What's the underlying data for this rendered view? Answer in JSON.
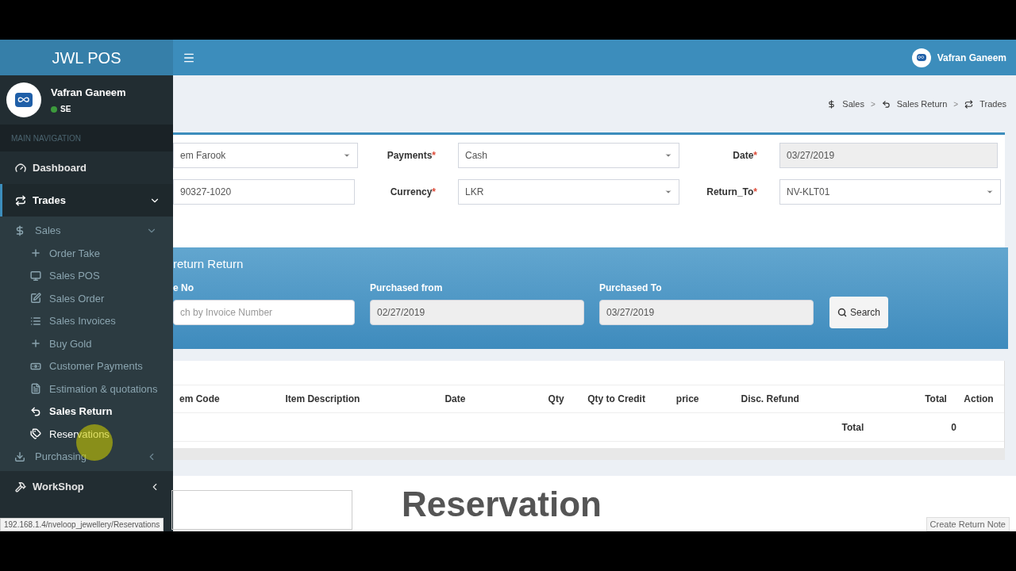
{
  "app_title": "JWL POS",
  "user": {
    "name": "Vafran Ganeem",
    "role": "SE",
    "online": true
  },
  "nav_heading": "MAIN NAVIGATION",
  "nav": [
    {
      "label": "Dashboard",
      "kind": "dashboard",
      "selected": false
    },
    {
      "label": "Trades",
      "kind": "trades",
      "expanded": true,
      "selected": true,
      "children": [
        {
          "label": "Sales",
          "kind": "dollar",
          "expanded": true,
          "children": [
            {
              "label": "Order Take",
              "kind": "plus",
              "selected": false,
              "hovered": false
            },
            {
              "label": "Sales POS",
              "kind": "monitor",
              "selected": false,
              "hovered": false
            },
            {
              "label": "Sales Order",
              "kind": "edit",
              "selected": false,
              "hovered": false
            },
            {
              "label": "Sales Invoices",
              "kind": "list",
              "selected": false,
              "hovered": false
            },
            {
              "label": "Buy Gold",
              "kind": "plus",
              "selected": false,
              "hovered": false
            },
            {
              "label": "Customer Payments",
              "kind": "money",
              "selected": false,
              "hovered": false
            },
            {
              "label": "Estimation & quotations",
              "kind": "file",
              "selected": false,
              "hovered": false
            },
            {
              "label": "Sales Return",
              "kind": "undo",
              "selected": true,
              "hovered": false
            },
            {
              "label": "Reservations",
              "kind": "tags",
              "selected": false,
              "hovered": true
            }
          ]
        },
        {
          "label": "Purchasing",
          "kind": "download",
          "expanded": false
        }
      ]
    },
    {
      "label": "WorkShop",
      "kind": "hammer",
      "expanded": false,
      "selected": false
    }
  ],
  "header_user": "Vafran Ganeem",
  "breadcrumb": [
    {
      "label": "Sales",
      "kind": "dollar"
    },
    {
      "label": "Sales Return",
      "kind": "undo"
    },
    {
      "label": "Trades",
      "kind": "trades"
    }
  ],
  "breadcrumb_separator": ">",
  "required_mark": "*",
  "form_rows": [
    [
      {
        "value": "em Farook",
        "kind": "select"
      },
      {
        "label": "Payments",
        "required": true,
        "value": "Cash",
        "kind": "select"
      },
      {
        "label": "Date",
        "required": true,
        "value": "03/27/2019",
        "kind": "readonly"
      }
    ],
    [
      {
        "value": "90327-1020",
        "kind": "text"
      },
      {
        "label": "Currency",
        "required": true,
        "value": "LKR",
        "kind": "select"
      },
      {
        "label": "Return_To",
        "required": true,
        "value": "NV-KLT01",
        "kind": "select"
      }
    ]
  ],
  "search_panel": {
    "title": "return Return",
    "fields": [
      {
        "label": "e No",
        "placeholder": "ch by Invoice Number",
        "kind": "text"
      },
      {
        "label": "Purchased from",
        "value": "02/27/2019",
        "kind": "readonly"
      },
      {
        "label": "Purchased To",
        "value": "03/27/2019",
        "kind": "readonly"
      }
    ],
    "button": "Search"
  },
  "table": {
    "columns": [
      "em Code",
      "Item Description",
      "Date",
      "Qty",
      "Qty to Credit",
      "price",
      "Disc. Refund",
      "Total",
      "Action"
    ],
    "footer": {
      "label": "Total",
      "value": "0"
    }
  },
  "caption": "Reservation",
  "create_button": "Create Return Note",
  "status_url": "192.168.1.4/nveloop_jewellery/Reservations"
}
